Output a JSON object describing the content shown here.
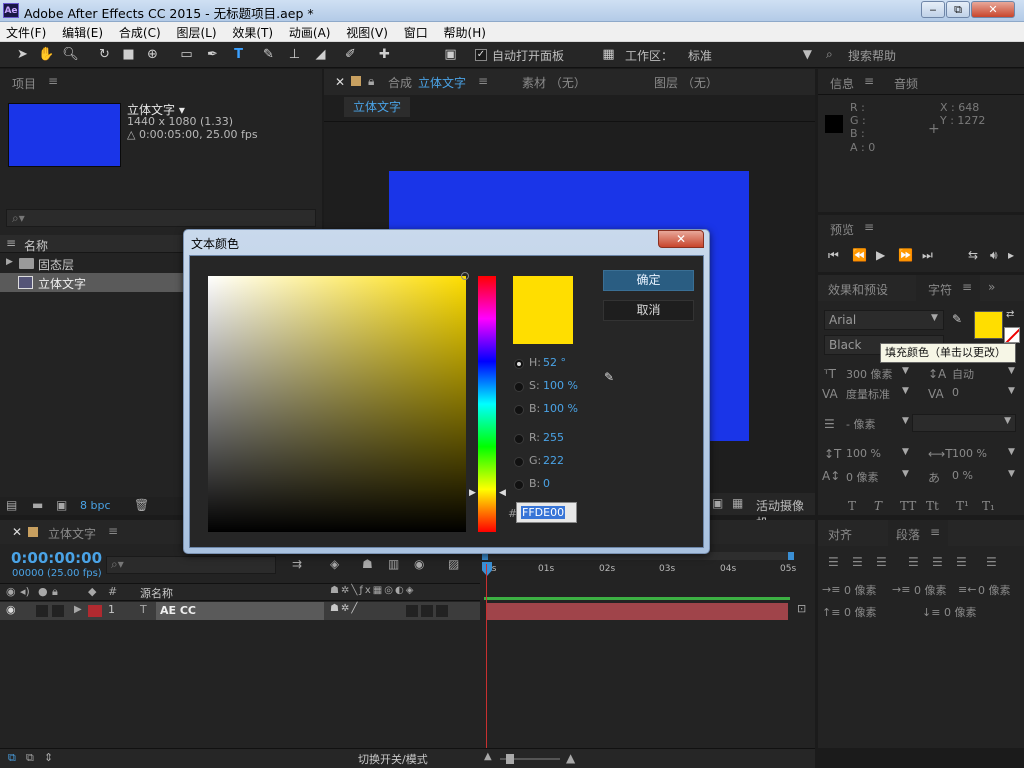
{
  "window": {
    "title": "Adobe After Effects CC 2015 - 无标题项目.aep *",
    "icon_label": "Ae",
    "minimize": "‒",
    "maximize": "⧉",
    "close": "✕"
  },
  "menu": [
    "文件(F)",
    "编辑(E)",
    "合成(C)",
    "图层(L)",
    "效果(T)",
    "动画(A)",
    "视图(V)",
    "窗口",
    "帮助(H)"
  ],
  "toolbar": {
    "auto_open_panels": "自动打开面板",
    "workspace_label": "工作区：",
    "workspace_value": "标准",
    "search_help": "搜索帮助"
  },
  "project": {
    "tab": "项目",
    "item_name": "立体文字 ▾",
    "item_size": "1440 x 1080 (1.33)",
    "item_duration": "△ 0:00:05:00, 25.00 fps",
    "search_placeholder": "",
    "column_name": "名称",
    "rows": [
      "固态层",
      "立体文字"
    ],
    "bpc": "8 bpc"
  },
  "composition": {
    "tab_prefix": "合成",
    "tab_name": "立体文字",
    "footage_tab": "素材 （无）",
    "layer_tab": "图层 （无）",
    "subtab": "立体文字",
    "camera_label": "活动摄像机"
  },
  "info": {
    "tab": "信息",
    "audio_tab": "音频",
    "r": "R :",
    "g": "G :",
    "b": "B :",
    "a": "A : 0",
    "x": "X : 648",
    "y": "Y : 1272"
  },
  "preview": {
    "tab": "预览"
  },
  "effects": {
    "tab": "效果和预设"
  },
  "character": {
    "tab": "字符",
    "font": "Arial",
    "style": "Black",
    "tooltip": "填充颜色（单击以更改）",
    "font_size": "300 像素",
    "leading": "自动",
    "kerning": "度量标准",
    "tracking": "0",
    "stroke_width": "- 像素",
    "vert_scale": "100 %",
    "horiz_scale": "100 %",
    "baseline": "0 像素",
    "tsume": "0 %",
    "styles": [
      "T",
      "T",
      "TT",
      "Tt",
      "T¹",
      "T₁"
    ]
  },
  "align": {
    "tab": "对齐"
  },
  "paragraph": {
    "tab": "段落",
    "indent_values": [
      "0 像素",
      "0 像素",
      "0 像素",
      "0 像素",
      "0 像素"
    ]
  },
  "timeline": {
    "tab": "立体文字",
    "timecode": "0:00:00:00",
    "frame_info": "00000 (25.00 fps)",
    "col_num": "#",
    "col_source": "源名称",
    "layer_num": "1",
    "layer_name": "AE CC",
    "ruler": [
      "0s",
      "01s",
      "02s",
      "03s",
      "04s",
      "05s"
    ],
    "toggle_modes": "切换开关/模式"
  },
  "dialog": {
    "title": "文本颜色",
    "ok": "确定",
    "cancel": "取消",
    "h_label": "H:",
    "h_value": "52 °",
    "s_label": "S:",
    "s_value": "100 %",
    "b_label": "B:",
    "b_value": "100 %",
    "r_label": "R:",
    "r_value": "255",
    "g_label": "G:",
    "g_value": "222",
    "b2_label": "B:",
    "b2_value": "0",
    "hex_label": "#",
    "hex_value": "FFDE00"
  },
  "colors": {
    "fill": "#FFDE00",
    "solid": "#1a35e8",
    "accent": "#4aa3e6"
  }
}
